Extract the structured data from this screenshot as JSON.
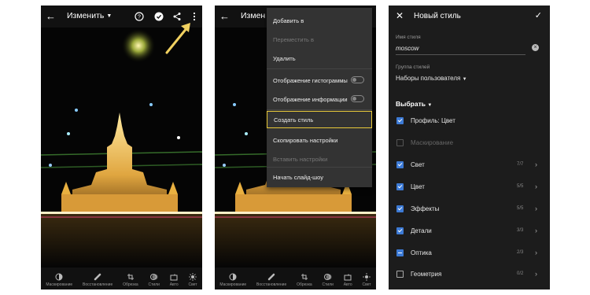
{
  "panel1": {
    "title": "Изменить",
    "tools": [
      {
        "label": "Маскирование",
        "icon": "mask-icon"
      },
      {
        "label": "Восстановление",
        "icon": "healing-icon"
      },
      {
        "label": "Обрезка",
        "icon": "crop-icon"
      },
      {
        "label": "Стили",
        "icon": "presets-icon"
      },
      {
        "label": "Авто",
        "icon": "auto-icon"
      },
      {
        "label": "Свет",
        "icon": "light-icon"
      }
    ]
  },
  "panel2": {
    "title": "Измен",
    "menu": [
      {
        "label": "Добавить в",
        "enabled": true
      },
      {
        "label": "Переместить в",
        "enabled": false
      },
      {
        "label": "Удалить",
        "enabled": true
      },
      {
        "label": "Отображение гистограммы",
        "enabled": true,
        "toggle": "off"
      },
      {
        "label": "Отображение информации",
        "enabled": true,
        "toggle": "off"
      },
      {
        "label": "Создать стиль",
        "enabled": true,
        "highlighted": true
      },
      {
        "label": "Скопировать настройки",
        "enabled": true
      },
      {
        "label": "Вставить настройки",
        "enabled": false
      },
      {
        "label": "Начать слайд-шоу",
        "enabled": true
      }
    ],
    "tools": [
      {
        "label": "Маскирование",
        "icon": "mask-icon"
      },
      {
        "label": "Восстановление",
        "icon": "healing-icon"
      },
      {
        "label": "Обрезка",
        "icon": "crop-icon"
      },
      {
        "label": "Стили",
        "icon": "presets-icon"
      },
      {
        "label": "Авто",
        "icon": "auto-icon"
      },
      {
        "label": "Свет",
        "icon": "light-icon"
      }
    ]
  },
  "panel3": {
    "title": "Новый стиль",
    "name_label": "Имя стиля",
    "name_value": "moscow",
    "group_label": "Группа стилей",
    "group_value": "Наборы пользователя",
    "select_label": "Выбрать",
    "items": [
      {
        "label": "Профиль: Цвет",
        "state": "checked",
        "count": ""
      },
      {
        "label": "Маскирование",
        "state": "disabled",
        "count": ""
      },
      {
        "label": "Свет",
        "state": "checked",
        "count": "7/7"
      },
      {
        "label": "Цвет",
        "state": "checked",
        "count": "5/5"
      },
      {
        "label": "Эффекты",
        "state": "checked",
        "count": "5/5"
      },
      {
        "label": "Детали",
        "state": "checked",
        "count": "3/3"
      },
      {
        "label": "Оптика",
        "state": "partial",
        "count": "2/3"
      },
      {
        "label": "Геометрия",
        "state": "unchecked",
        "count": "0/2"
      }
    ]
  },
  "colors": {
    "accent_highlight": "#e8c93a",
    "checkbox_blue": "#3d7bd6",
    "menu_bg": "#333333"
  }
}
